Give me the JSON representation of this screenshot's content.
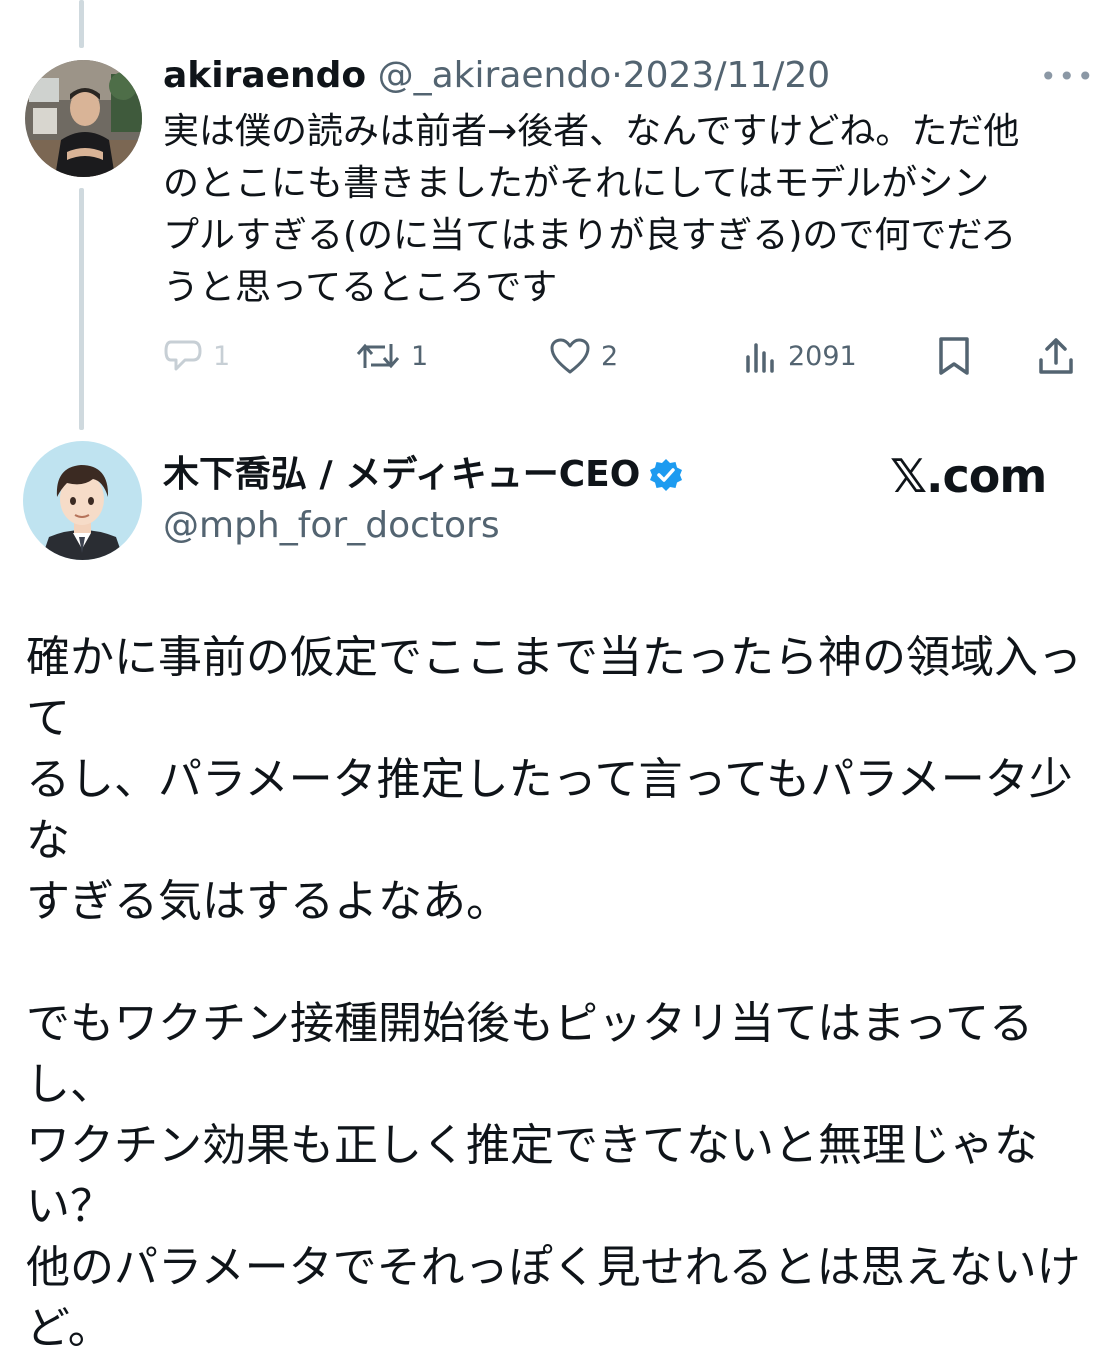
{
  "reply": {
    "display_name": "akiraendo",
    "handle": "@_akiraendo",
    "separator": "·",
    "date": "2023/11/20",
    "more_icon": "more-horizontal-icon",
    "text": "実は僕の読みは前者→後者、なんですけどね。ただ他\nのとこにも書きましたがそれにしてはモデルがシン\nプルすぎる(のに当てはまりが良すぎる)ので何でだろ\nうと思ってるところです",
    "actions": {
      "reply_count": "1",
      "repost_count": "1",
      "like_count": "2",
      "view_count": "2091"
    }
  },
  "main": {
    "display_name": "木下喬弘 / メディキューCEO",
    "handle": "@mph_for_doctors",
    "verified_icon": "verified-badge-icon",
    "text": "確かに事前の仮定でここまで当たったら神の領域入って\nるし、パラメータ推定したって言ってもパラメータ少な\nすぎる気はするよなあ。\n\nでもワクチン接種開始後もピッタリ当てはまってるし、\nワクチン効果も正しく推定できてないと無理じゃない？\n他のパラメータでそれっぽく見せれるとは思えないけ\nど。"
  },
  "brand": "𝕏.com",
  "colors": {
    "text": "#0f1419",
    "secondary": "#536471",
    "thread_line": "#cfd9de",
    "verified": "#1d9bf0"
  }
}
